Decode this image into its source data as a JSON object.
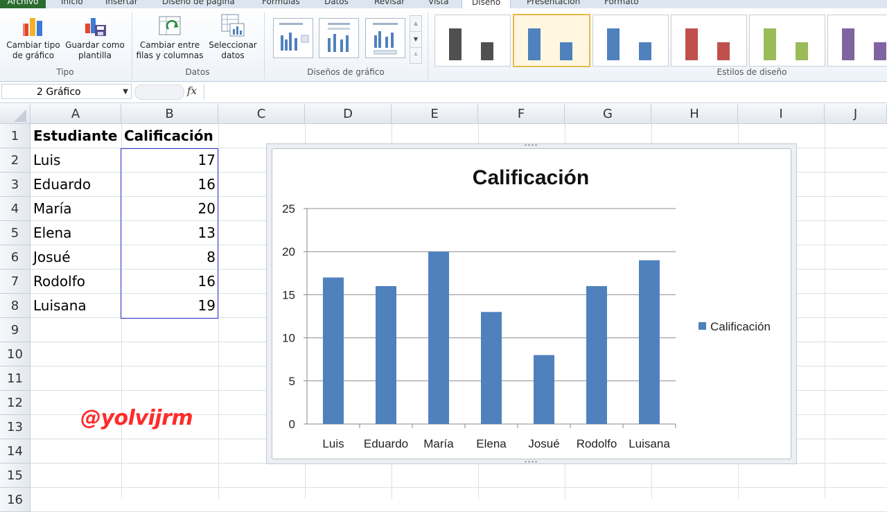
{
  "ribbon": {
    "tabs": [
      "Archivo",
      "Inicio",
      "Insertar",
      "Diseño de página",
      "Fórmulas",
      "Datos",
      "Revisar",
      "Vista",
      "Diseño",
      "Presentación",
      "Formato"
    ],
    "active_tab": "Diseño",
    "buttons": {
      "change_type": [
        "Cambiar tipo",
        "de gráfico"
      ],
      "save_template": [
        "Guardar como",
        "plantilla"
      ],
      "switch_row_col": [
        "Cambiar entre",
        "filas y columnas"
      ],
      "select_data": [
        "Seleccionar",
        "datos"
      ]
    },
    "groups": {
      "type": "Tipo",
      "data": "Datos",
      "layouts": "Diseños de gráfico",
      "styles": "Estilos de diseño"
    },
    "style_colors": [
      "#505050",
      "#4f81bd",
      "#4f81bd",
      "#c0504d",
      "#9bbb59",
      "#8064a2"
    ]
  },
  "formula_bar": {
    "name_box": "2 Gráfico",
    "fx_label": "fx",
    "content": ""
  },
  "sheet": {
    "columns": [
      "A",
      "B",
      "C",
      "D",
      "E",
      "F",
      "G",
      "H",
      "I",
      "J"
    ],
    "rows": [
      "1",
      "2",
      "3",
      "4",
      "5",
      "6",
      "7",
      "8",
      "9",
      "10",
      "11",
      "12",
      "13",
      "14",
      "15",
      "16"
    ],
    "header": [
      "Estudiante",
      "Calificación"
    ],
    "data": [
      [
        "Luis",
        "17"
      ],
      [
        "Eduardo",
        "16"
      ],
      [
        "María",
        "20"
      ],
      [
        "Elena",
        "13"
      ],
      [
        "Josué",
        "8"
      ],
      [
        "Rodolfo",
        "16"
      ],
      [
        "Luisana",
        "19"
      ]
    ]
  },
  "watermark": "@yolvijrm",
  "chart_data": {
    "type": "bar",
    "title": "Calificación",
    "categories": [
      "Luis",
      "Eduardo",
      "María",
      "Elena",
      "Josué",
      "Rodolfo",
      "Luisana"
    ],
    "series": [
      {
        "name": "Calificación",
        "values": [
          17,
          16,
          20,
          13,
          8,
          16,
          19
        ],
        "color": "#4f81bd"
      }
    ],
    "ylim": [
      0,
      25
    ],
    "yticks": [
      0,
      5,
      10,
      15,
      20,
      25
    ],
    "grid": true,
    "legend": "right"
  }
}
